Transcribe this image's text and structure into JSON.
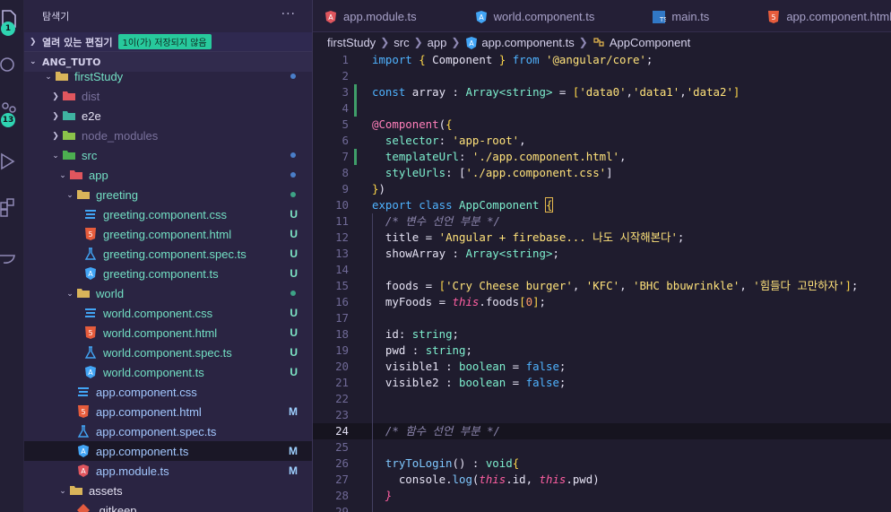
{
  "colors": {
    "accent": "#27c99c",
    "untracked": "#7ee6c6",
    "modified": "#9fd0ff",
    "keyword": "#4fb3ff",
    "string": "#ffe27a",
    "type": "#7ef0cf"
  },
  "activity_bar": {
    "explorer_badge": "1",
    "scm_badge": "13"
  },
  "sidebar": {
    "title": "탐색기",
    "more_icon": "ellipsis-icon",
    "open_editors": {
      "label": "열려 있는 편집기",
      "badge": "1이(가) 저장되지 않음"
    },
    "project": "ANG_TUTO",
    "tree": [
      {
        "name": "firstStudy",
        "icon": "folder-open-icon",
        "chev": "open",
        "indent": 0,
        "dot": "blue",
        "cls": "teal"
      },
      {
        "name": "dist",
        "icon": "folder-dist-icon",
        "chev": "closed",
        "indent": 1,
        "cls": "dim"
      },
      {
        "name": "e2e",
        "icon": "folder-e2e-icon",
        "chev": "closed",
        "indent": 1
      },
      {
        "name": "node_modules",
        "icon": "folder-node-icon",
        "chev": "closed",
        "indent": 1,
        "cls": "dim"
      },
      {
        "name": "src",
        "icon": "folder-src-icon",
        "chev": "open",
        "indent": 1,
        "dot": "blue",
        "cls": "teal"
      },
      {
        "name": "app",
        "icon": "folder-app-icon",
        "chev": "open",
        "indent": 2,
        "dot": "blue",
        "cls": "teal"
      },
      {
        "name": "greeting",
        "icon": "folder-open-icon",
        "chev": "open",
        "indent": 3,
        "dot": "green",
        "cls": "teal"
      },
      {
        "name": "greeting.component.css",
        "icon": "css-icon",
        "indent": 4,
        "status": "U",
        "cls": "teal"
      },
      {
        "name": "greeting.component.html",
        "icon": "html-icon",
        "indent": 4,
        "status": "U",
        "cls": "teal"
      },
      {
        "name": "greeting.component.spec.ts",
        "icon": "test-icon",
        "indent": 4,
        "status": "U",
        "cls": "teal"
      },
      {
        "name": "greeting.component.ts",
        "icon": "angular-icon",
        "indent": 4,
        "status": "U",
        "cls": "teal"
      },
      {
        "name": "world",
        "icon": "folder-open-icon",
        "chev": "open",
        "indent": 3,
        "dot": "green",
        "cls": "teal"
      },
      {
        "name": "world.component.css",
        "icon": "css-icon",
        "indent": 4,
        "status": "U",
        "cls": "teal"
      },
      {
        "name": "world.component.html",
        "icon": "html-icon",
        "indent": 4,
        "status": "U",
        "cls": "teal"
      },
      {
        "name": "world.component.spec.ts",
        "icon": "test-icon",
        "indent": 4,
        "status": "U",
        "cls": "teal"
      },
      {
        "name": "world.component.ts",
        "icon": "angular-icon",
        "indent": 4,
        "status": "U",
        "cls": "teal"
      },
      {
        "name": "app.component.css",
        "icon": "css-icon",
        "indent": 3,
        "cls": "mod"
      },
      {
        "name": "app.component.html",
        "icon": "html-icon",
        "indent": 3,
        "status": "M",
        "cls": "mod"
      },
      {
        "name": "app.component.spec.ts",
        "icon": "test-icon",
        "indent": 3,
        "cls": "mod"
      },
      {
        "name": "app.component.ts",
        "icon": "angular-icon",
        "indent": 3,
        "status": "M",
        "cls": "mod",
        "selected": true
      },
      {
        "name": "app.module.ts",
        "icon": "angular-red-icon",
        "indent": 3,
        "status": "M",
        "cls": "mod"
      },
      {
        "name": "assets",
        "icon": "folder-open-icon",
        "chev": "open",
        "indent": 2
      },
      {
        "name": ".gitkeep",
        "icon": "git-icon",
        "indent": 3
      }
    ]
  },
  "tabs": [
    {
      "label": "app.module.ts",
      "icon": "angular-red-icon"
    },
    {
      "label": "world.component.ts",
      "icon": "angular-icon"
    },
    {
      "label": "main.ts",
      "icon": "ts-icon"
    },
    {
      "label": "app.component.html",
      "icon": "html-icon"
    }
  ],
  "breadcrumb": [
    "firstStudy",
    "src",
    "app",
    "app.component.ts",
    "AppComponent"
  ],
  "code": {
    "current_line": 24,
    "lines": [
      {
        "n": "1",
        "t": [
          [
            "import",
            "k"
          ],
          [
            " { ",
            "p"
          ],
          [
            "Component",
            "id"
          ],
          [
            " } ",
            "p"
          ],
          [
            "from",
            "k"
          ],
          [
            " '@angular/core'",
            "s"
          ],
          [
            ";",
            "id"
          ]
        ]
      },
      {
        "n": "2",
        "t": []
      },
      {
        "n": "3",
        "mod": true,
        "t": [
          [
            "const",
            "k"
          ],
          [
            " array ",
            "id"
          ],
          [
            ": ",
            "id"
          ],
          [
            "Array",
            "t"
          ],
          [
            "<string>",
            "t"
          ],
          [
            " = ",
            "id"
          ],
          [
            "[",
            "p"
          ],
          [
            "'data0'",
            "s"
          ],
          [
            ",",
            "id"
          ],
          [
            "'data1'",
            "s"
          ],
          [
            ",",
            "id"
          ],
          [
            "'data2'",
            "s"
          ],
          [
            "]",
            "p"
          ]
        ]
      },
      {
        "n": "4",
        "mod": true,
        "t": []
      },
      {
        "n": "5",
        "t": [
          [
            "@Component",
            "dec"
          ],
          [
            "(",
            "id"
          ],
          [
            "{",
            "p"
          ]
        ]
      },
      {
        "n": "6",
        "t": [
          [
            "  selector",
            "t"
          ],
          [
            ": ",
            "id"
          ],
          [
            "'app-root'",
            "s"
          ],
          [
            ",",
            "id"
          ]
        ]
      },
      {
        "n": "7",
        "mod": true,
        "t": [
          [
            "  templateUrl",
            "t"
          ],
          [
            ": ",
            "id"
          ],
          [
            "'./app.component.html'",
            "s"
          ],
          [
            ",",
            "id"
          ]
        ]
      },
      {
        "n": "8",
        "t": [
          [
            "  styleUrls",
            "t"
          ],
          [
            ": ",
            "id"
          ],
          [
            "[",
            "id"
          ],
          [
            "'./app.component.css'",
            "s"
          ],
          [
            "]",
            "id"
          ]
        ]
      },
      {
        "n": "9",
        "t": [
          [
            "}",
            "p"
          ],
          [
            ")",
            "id"
          ]
        ]
      },
      {
        "n": "10",
        "t": [
          [
            "export",
            "k"
          ],
          [
            " class",
            "k"
          ],
          [
            " AppComponent",
            "t"
          ],
          [
            " ",
            "id"
          ],
          [
            "{",
            "p"
          ]
        ]
      },
      {
        "n": "11",
        "guide": true,
        "t": [
          [
            "  /* 변수 선언 부분 */",
            "c"
          ]
        ]
      },
      {
        "n": "12",
        "guide": true,
        "t": [
          [
            "  title",
            "id"
          ],
          [
            " = ",
            "id"
          ],
          [
            "'Angular + firebase... 나도 시작해본다'",
            "s"
          ],
          [
            ";",
            "id"
          ]
        ]
      },
      {
        "n": "13",
        "guide": true,
        "t": [
          [
            "  showArray",
            "id"
          ],
          [
            " : ",
            "id"
          ],
          [
            "Array<string>",
            "t"
          ],
          [
            ";",
            "id"
          ]
        ]
      },
      {
        "n": "14",
        "guide": true,
        "t": []
      },
      {
        "n": "15",
        "guide": true,
        "t": [
          [
            "  foods",
            "id"
          ],
          [
            " = ",
            "id"
          ],
          [
            "[",
            "p"
          ],
          [
            "'Cry Cheese burger'",
            "s"
          ],
          [
            ", ",
            "id"
          ],
          [
            "'KFC'",
            "s"
          ],
          [
            ", ",
            "id"
          ],
          [
            "'BHC bbuwrinkle'",
            "s"
          ],
          [
            ", ",
            "id"
          ],
          [
            "'힘들다 고만하자'",
            "s"
          ],
          [
            "]",
            "p"
          ],
          [
            ";",
            "id"
          ]
        ]
      },
      {
        "n": "16",
        "guide": true,
        "t": [
          [
            "  myFoods",
            "id"
          ],
          [
            " = ",
            "id"
          ],
          [
            "this",
            "kp"
          ],
          [
            ".foods",
            "id"
          ],
          [
            "[",
            "p"
          ],
          [
            "0",
            "num"
          ],
          [
            "]",
            "p"
          ],
          [
            ";",
            "id"
          ]
        ]
      },
      {
        "n": "17",
        "guide": true,
        "t": []
      },
      {
        "n": "18",
        "guide": true,
        "t": [
          [
            "  id",
            "id"
          ],
          [
            ": ",
            "id"
          ],
          [
            "string",
            "t"
          ],
          [
            ";",
            "id"
          ]
        ]
      },
      {
        "n": "19",
        "guide": true,
        "t": [
          [
            "  pwd",
            "id"
          ],
          [
            " : ",
            "id"
          ],
          [
            "string",
            "t"
          ],
          [
            ";",
            "id"
          ]
        ]
      },
      {
        "n": "20",
        "guide": true,
        "t": [
          [
            "  visible1",
            "id"
          ],
          [
            " : ",
            "id"
          ],
          [
            "boolean",
            "t"
          ],
          [
            " = ",
            "id"
          ],
          [
            "false",
            "k"
          ],
          [
            ";",
            "id"
          ]
        ]
      },
      {
        "n": "21",
        "guide": true,
        "t": [
          [
            "  visible2",
            "id"
          ],
          [
            " : ",
            "id"
          ],
          [
            "boolean",
            "t"
          ],
          [
            " = ",
            "id"
          ],
          [
            "false",
            "k"
          ],
          [
            ";",
            "id"
          ]
        ]
      },
      {
        "n": "22",
        "guide": true,
        "t": []
      },
      {
        "n": "23",
        "guide": true,
        "t": []
      },
      {
        "n": "24",
        "guide": true,
        "t": [
          [
            "  /* 함수 선언 부분 */",
            "c"
          ]
        ]
      },
      {
        "n": "25",
        "guide": true,
        "t": []
      },
      {
        "n": "26",
        "guide": true,
        "t": [
          [
            "  tryToLogin",
            "f"
          ],
          [
            "() ",
            "id"
          ],
          [
            ": ",
            "id"
          ],
          [
            "void",
            "t"
          ],
          [
            "{",
            "p"
          ]
        ]
      },
      {
        "n": "27",
        "guide": true,
        "t": [
          [
            "    console",
            "id"
          ],
          [
            ".",
            "id"
          ],
          [
            "log",
            "f"
          ],
          [
            "(",
            "id"
          ],
          [
            "this",
            "kp"
          ],
          [
            ".id, ",
            "id"
          ],
          [
            "this",
            "kp"
          ],
          [
            ".pwd)",
            "id"
          ]
        ]
      },
      {
        "n": "28",
        "guide": true,
        "t": [
          [
            "  }",
            "kp"
          ]
        ]
      },
      {
        "n": "29",
        "guide": true,
        "t": []
      }
    ]
  }
}
